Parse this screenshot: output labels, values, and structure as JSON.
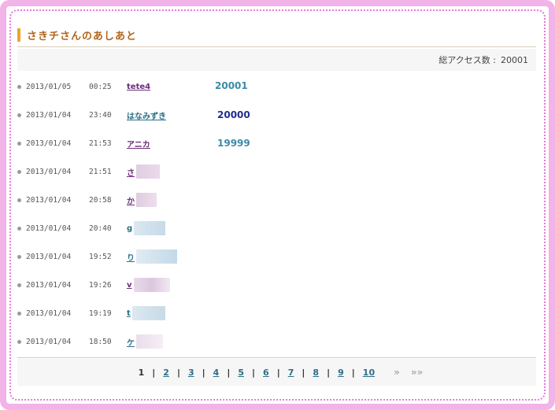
{
  "header": {
    "title": "さきチさんのあしあと"
  },
  "summary": {
    "label": "総アクセス数 :",
    "value": "20001"
  },
  "visits": [
    {
      "date": "2013/01/05",
      "time": "00:25",
      "name": "tete4",
      "count": "20001"
    },
    {
      "date": "2013/01/04",
      "time": "23:40",
      "name": "はなみずき",
      "count": "20000"
    },
    {
      "date": "2013/01/04",
      "time": "21:53",
      "name": "アニカ",
      "count": "19999"
    },
    {
      "date": "2013/01/04",
      "time": "21:51",
      "name": "さ"
    },
    {
      "date": "2013/01/04",
      "time": "20:58",
      "name": "か"
    },
    {
      "date": "2013/01/04",
      "time": "20:40",
      "name": "g"
    },
    {
      "date": "2013/01/04",
      "time": "19:52",
      "name": "り"
    },
    {
      "date": "2013/01/04",
      "time": "19:26",
      "name": "v"
    },
    {
      "date": "2013/01/04",
      "time": "19:19",
      "name": "t"
    },
    {
      "date": "2013/01/04",
      "time": "18:50",
      "name": "ケ"
    }
  ],
  "pagination": {
    "pages": [
      "1",
      "2",
      "3",
      "4",
      "5",
      "6",
      "7",
      "8",
      "9",
      "10"
    ],
    "current": "1",
    "sep": "|",
    "next": "»",
    "last": "»»"
  },
  "colors": {
    "frame": "#f2b3e8",
    "title": "#b0661b",
    "accent_bar": "#f0a42c",
    "count_teal": "#3d8aa6",
    "count_blue": "#1f2e8f",
    "link_purple": "#6b2c7a",
    "link_teal": "#2c6f87"
  },
  "icons": {
    "row_bullet": "bullet-dot-icon",
    "next": "next-arrow-icon",
    "last": "last-arrow-icon"
  }
}
